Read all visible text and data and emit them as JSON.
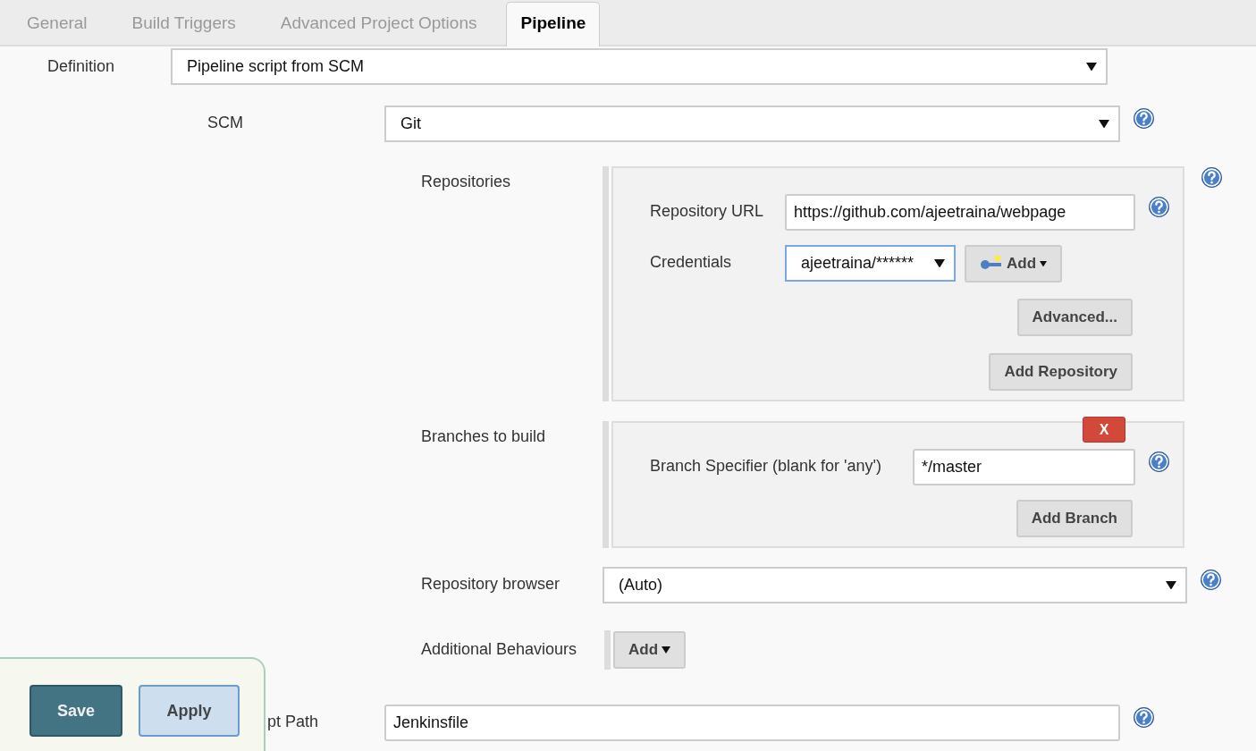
{
  "tabs": [
    {
      "label": "General",
      "selected": false
    },
    {
      "label": "Build Triggers",
      "selected": false
    },
    {
      "label": "Advanced Project Options",
      "selected": false
    },
    {
      "label": "Pipeline",
      "selected": true
    }
  ],
  "definition": {
    "label": "Definition",
    "value": "Pipeline script from SCM"
  },
  "scm": {
    "label": "SCM",
    "value": "Git"
  },
  "repositories": {
    "label": "Repositories",
    "url_label": "Repository URL",
    "url": "https://github.com/ajeetraina/webpage",
    "credentials_label": "Credentials",
    "credentials": "ajeetraina/******",
    "add_label": "Add",
    "advanced": "Advanced...",
    "add_repository": "Add Repository"
  },
  "branches": {
    "label": "Branches to build",
    "delete": "X",
    "specifier_label": "Branch Specifier (blank for 'any')",
    "specifier": "*/master",
    "add_branch": "Add Branch"
  },
  "repository_browser": {
    "label": "Repository browser",
    "value": "(Auto)"
  },
  "additional_behaviours": {
    "label": "Additional Behaviours",
    "add": "Add"
  },
  "script_path": {
    "label": "pt Path",
    "value": "Jenkinsfile"
  },
  "actions": [
    {
      "label": "Save",
      "kind": "primary"
    },
    {
      "label": "Apply",
      "kind": "secondary"
    }
  ]
}
